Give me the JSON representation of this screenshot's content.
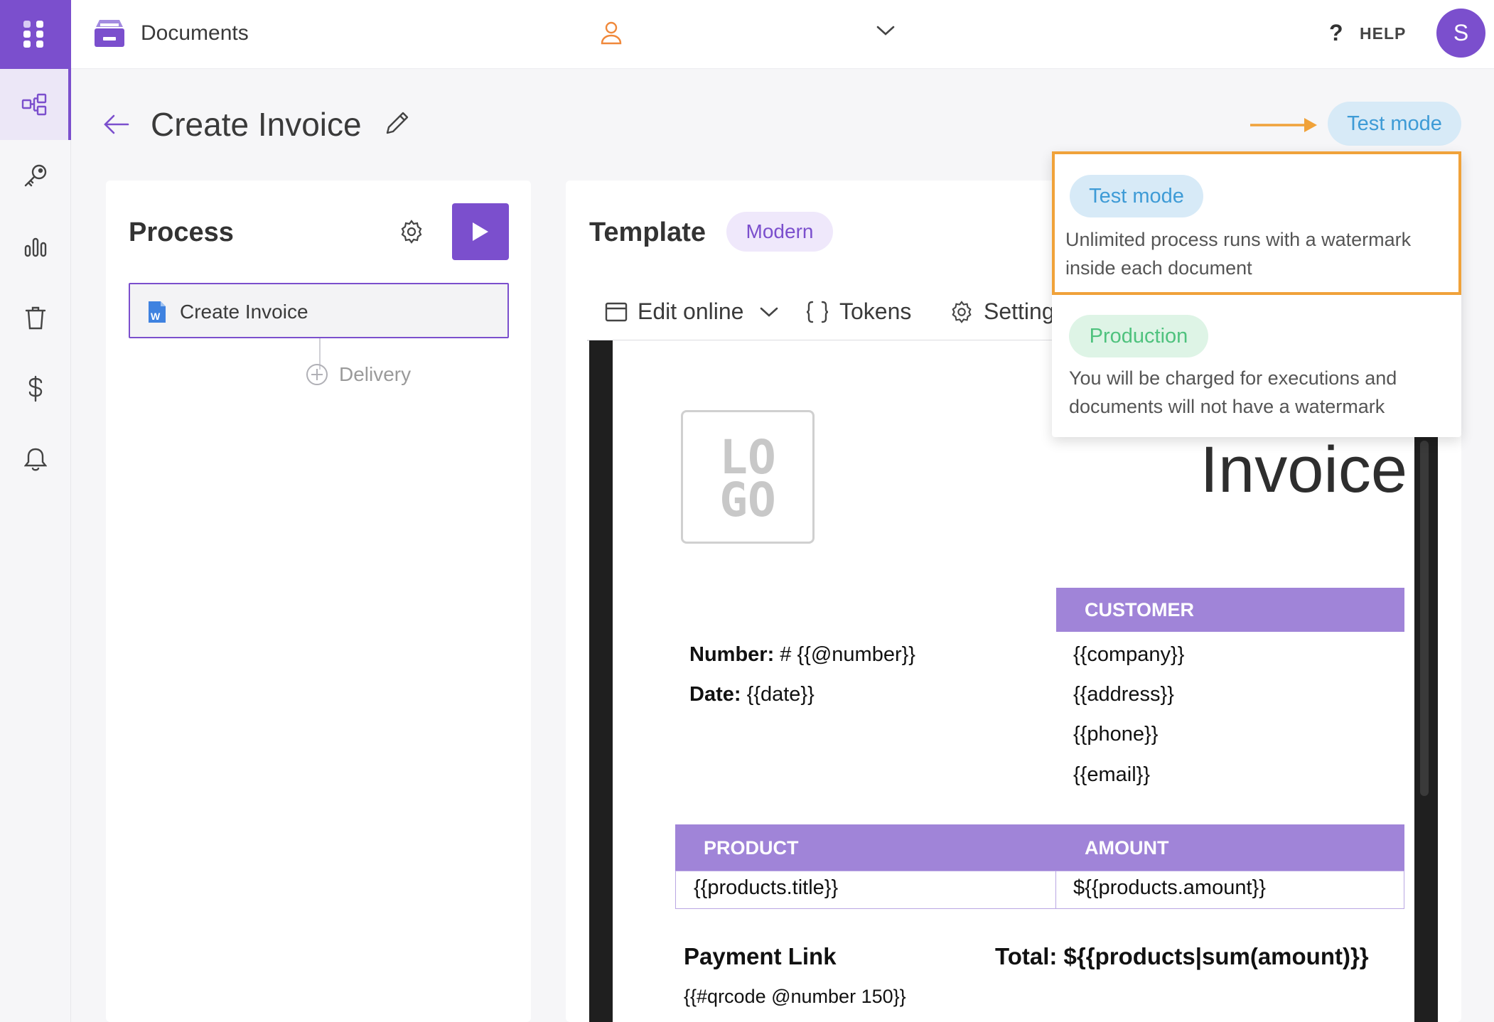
{
  "app": {
    "title": "Documents",
    "help_label": "HELP",
    "help_icon_glyph": "?",
    "avatar_initial": "S"
  },
  "sidebar": {
    "items": [
      {
        "icon": "workflow-icon",
        "active": true
      },
      {
        "icon": "key-icon",
        "active": false
      },
      {
        "icon": "bar-chart-icon",
        "active": false
      },
      {
        "icon": "trash-icon",
        "active": false
      },
      {
        "icon": "dollar-icon",
        "active": false
      },
      {
        "icon": "bell-icon",
        "active": false
      }
    ]
  },
  "header": {
    "title": "Create Invoice",
    "mode_label": "Test mode"
  },
  "process": {
    "title": "Process",
    "step_label": "Create Invoice",
    "add_delivery_label": "Delivery"
  },
  "template": {
    "title": "Template",
    "style_tag": "Modern",
    "toolbar": {
      "edit_online": "Edit online",
      "tokens": "Tokens",
      "settings": "Setting"
    }
  },
  "document": {
    "logo_text_top": "LO",
    "logo_text_bottom": "GO",
    "title": "Invoice",
    "customer_header": "CUSTOMER",
    "number_label": "Number:",
    "number_value": "# {{@number}}",
    "date_label": "Date:",
    "date_value": "{{date}}",
    "customer_fields": [
      "{{company}}",
      "{{address}}",
      "{{phone}}",
      "{{email}}"
    ],
    "table": {
      "headers": [
        "PRODUCT",
        "AMOUNT"
      ],
      "row": [
        "{{products.title}}",
        "${{products.amount}}"
      ]
    },
    "payment_link_label": "Payment Link",
    "total_label": "Total: ${{products|sum(amount)}}",
    "qrcode_value": "{{#qrcode @number 150}}"
  },
  "mode_dropdown": {
    "options": [
      {
        "label": "Test mode",
        "description_line1": "Unlimited process runs with a watermark",
        "description_line2": "inside each document",
        "highlighted": true
      },
      {
        "label": "Production",
        "description_line1": "You will be charged for executions and",
        "description_line2": "documents will not have a watermark",
        "highlighted": false
      }
    ]
  },
  "colors": {
    "brand": "#7b4fcd",
    "test_mode_bg": "#d7eaf7",
    "test_mode_text": "#3e9bd6",
    "production_bg": "#def4e6",
    "production_text": "#4fc27e",
    "callout": "#f0a23a",
    "table_header": "#a084d8"
  }
}
